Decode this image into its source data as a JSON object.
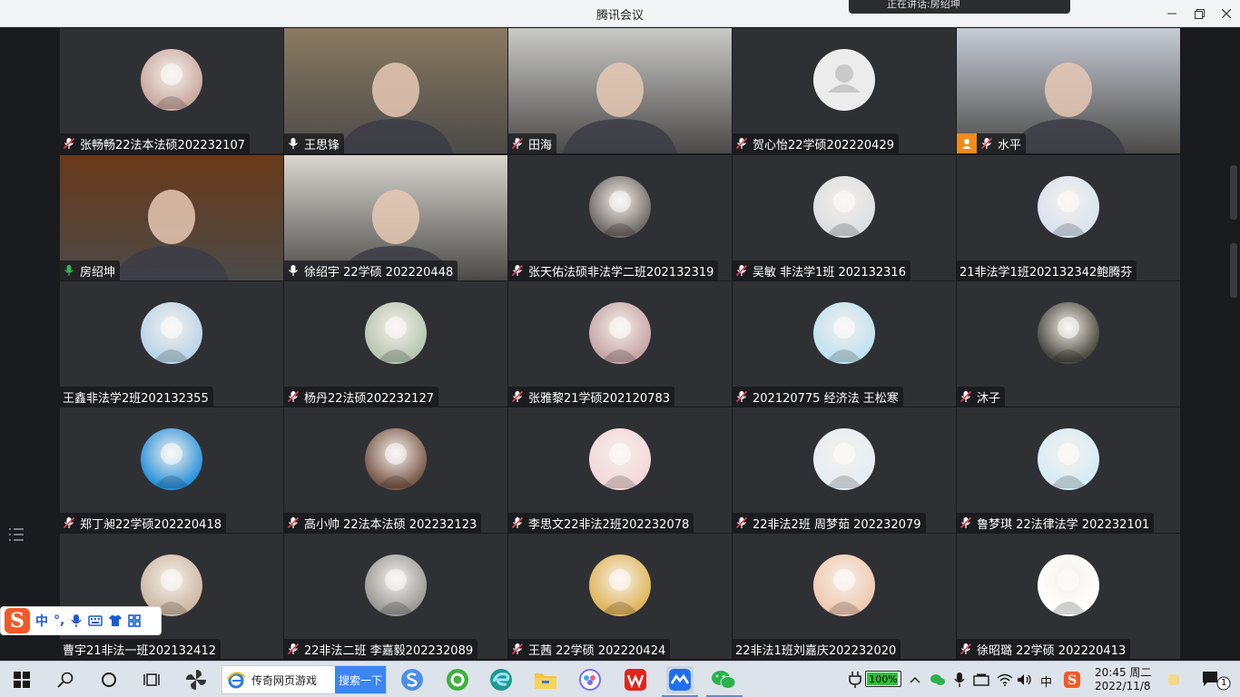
{
  "window": {
    "title": "腾讯会议",
    "toast_text": "正在讲话:房绍坤"
  },
  "participants": [
    {
      "name": "张畅畅22法本法硕202232107",
      "mic": "muted",
      "kind": "avatar",
      "color": "#c9a9a0"
    },
    {
      "name": "王思锋",
      "mic": "on",
      "kind": "video",
      "color": "#8a7a62"
    },
    {
      "name": "田海",
      "mic": "muted",
      "kind": "video",
      "color": "#c9c9c7"
    },
    {
      "name": "贺心怡22学硕202220429",
      "mic": "muted",
      "kind": "default",
      "color": "#ececec"
    },
    {
      "name": "水平",
      "mic": "muted",
      "kind": "video",
      "color": "#c7ccd6",
      "host": true
    },
    {
      "name": "房绍坤",
      "mic": "speaking",
      "kind": "video",
      "color": "#6a3a1a",
      "active": true
    },
    {
      "name": "徐绍宇 22学硕 202220448",
      "mic": "on",
      "kind": "video",
      "color": "#d9d6d0"
    },
    {
      "name": "张天佑法硕非法学二班202132319",
      "mic": "muted",
      "kind": "avatar",
      "color": "#6e6a66"
    },
    {
      "name": "吴敏 非法学1班 202132316",
      "mic": "muted",
      "kind": "avatar",
      "color": "#dcdfe3"
    },
    {
      "name": "21非法学1班202132342鲍腾芬",
      "mic": "none",
      "kind": "avatar",
      "color": "#d9e3f0"
    },
    {
      "name": "王鑫非法学2班202132355",
      "mic": "none",
      "kind": "avatar",
      "color": "#b9d4ea"
    },
    {
      "name": "杨丹22法硕202232127",
      "mic": "muted",
      "kind": "avatar",
      "color": "#b7c6b0"
    },
    {
      "name": "张雅黎21学硕202120783",
      "mic": "muted",
      "kind": "avatar",
      "color": "#c6a4a6"
    },
    {
      "name": "202120775 经济法 王松寒",
      "mic": "muted",
      "kind": "avatar",
      "color": "#bfe2f2"
    },
    {
      "name": "沐子",
      "mic": "muted",
      "kind": "avatar",
      "color": "#4a4a40"
    },
    {
      "name": "郑丁昶22学硕202220418",
      "mic": "muted",
      "kind": "avatar",
      "color": "#2a93dd"
    },
    {
      "name": "高小帅 22法本法硕 202232123",
      "mic": "muted",
      "kind": "avatar",
      "color": "#7a5a4a"
    },
    {
      "name": "李思文22非法2班202232078",
      "mic": "muted",
      "kind": "avatar",
      "color": "#f3d7da"
    },
    {
      "name": "22非法2班 周梦茹 202232079",
      "mic": "muted",
      "kind": "avatar",
      "color": "#e6eef5"
    },
    {
      "name": "鲁梦琪 22法律法学 202232101",
      "mic": "muted",
      "kind": "avatar",
      "color": "#d5ecf7"
    },
    {
      "name": "曹宇21非法一班202132412",
      "mic": "none",
      "kind": "avatar",
      "color": "#cdb8a4"
    },
    {
      "name": "22非法二班 李嘉毅202232089",
      "mic": "muted",
      "kind": "avatar",
      "color": "#9a9a96"
    },
    {
      "name": "王茜 22学硕 202220424",
      "mic": "muted",
      "kind": "avatar",
      "color": "#e0b55a"
    },
    {
      "name": "22非法1班刘嘉庆202232020",
      "mic": "none",
      "kind": "avatar",
      "color": "#f0c9b0"
    },
    {
      "name": "徐昭璐 22学硕 202220413",
      "mic": "muted",
      "kind": "avatar",
      "color": "#ffffff"
    }
  ],
  "ime": {
    "mode": "中",
    "punct": "°,"
  },
  "taskbar": {
    "search_label": "传奇网页游戏",
    "search_button": "搜索一下",
    "battery": "100%",
    "ime_indicator": "中",
    "time": "20:45 周二",
    "date": "2022/11/8",
    "notifications": "1"
  },
  "colors": {
    "tile_bg": "#2f3034",
    "speaking": "#2fb456",
    "muted": "#e0424b",
    "host": "#f28a1c"
  }
}
